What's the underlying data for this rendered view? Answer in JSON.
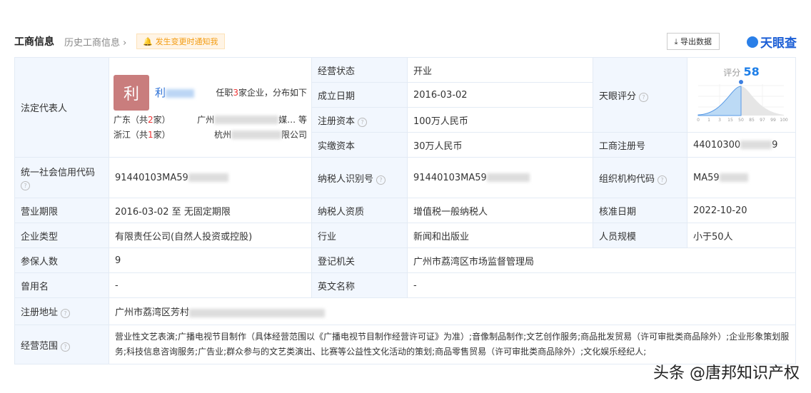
{
  "header": {
    "title": "工商信息",
    "history": "历史工商信息",
    "notify": "发生变更时通知我",
    "export": "导出数据",
    "logo": "天眼查"
  },
  "legal": {
    "label": "法定代表人",
    "avatar": "利",
    "name": "利",
    "roles_pre": "任职",
    "roles_count": "3",
    "roles_post": "家企业，分布如下",
    "regions": [
      {
        "name": "广东（共",
        "count": "2",
        "suffix": "家）",
        "company": "广州",
        "company_end": "媒…  等"
      },
      {
        "name": "浙江（共",
        "count": "1",
        "suffix": "家）",
        "company": "杭州",
        "company_end": "限公司"
      }
    ]
  },
  "rows_top": [
    {
      "label": "经营状态",
      "value": "开业"
    },
    {
      "label": "成立日期",
      "value": "2016-03-02"
    },
    {
      "label": "注册资本",
      "value": "100万人民币"
    },
    {
      "label": "实缴资本",
      "value": "30万人民币"
    }
  ],
  "score": {
    "label": "天眼评分",
    "title": "评分",
    "value": "58",
    "ticks": [
      "0",
      "1",
      "3",
      "15",
      "50",
      "85",
      "97",
      "99",
      "100"
    ]
  },
  "reg_no": {
    "label": "工商注册号",
    "value": "44010300",
    "value_end": "9"
  },
  "credit": {
    "label": "统一社会信用代码",
    "value": "91440103MA59"
  },
  "taxid": {
    "label": "纳税人识别号",
    "value": "91440103MA59"
  },
  "orgcode": {
    "label": "组织机构代码",
    "value": "MA59"
  },
  "term": {
    "label": "营业期限",
    "value": "2016-03-02 至 无固定期限"
  },
  "taxq": {
    "label": "纳税人资质",
    "value": "增值税一般纳税人"
  },
  "approve": {
    "label": "核准日期",
    "value": "2022-10-20"
  },
  "type": {
    "label": "企业类型",
    "value": "有限责任公司(自然人投资或控股)"
  },
  "industry": {
    "label": "行业",
    "value": "新闻和出版业"
  },
  "staff": {
    "label": "人员规模",
    "value": "小于50人"
  },
  "insured": {
    "label": "参保人数",
    "value": "9"
  },
  "authority": {
    "label": "登记机关",
    "value": "广州市荔湾区市场监督管理局"
  },
  "former": {
    "label": "曾用名",
    "value": "-"
  },
  "english": {
    "label": "英文名称",
    "value": "-"
  },
  "address": {
    "label": "注册地址",
    "value": "广州市荔湾区芳村"
  },
  "scope": {
    "label": "经营范围",
    "value": "营业性文艺表演;广播电视节目制作（具体经营范围以《广播电视节目制作经营许可证》为准）;音像制品制作;文艺创作服务;商品批发贸易（许可审批类商品除外）;企业形象策划服务;科技信息咨询服务;广告业;群众参与的文艺类演出、比赛等公益性文化活动的策划;商品零售贸易（许可审批类商品除外）;文化娱乐经纪人;"
  },
  "watermark": "头条 @唐邦知识产权"
}
